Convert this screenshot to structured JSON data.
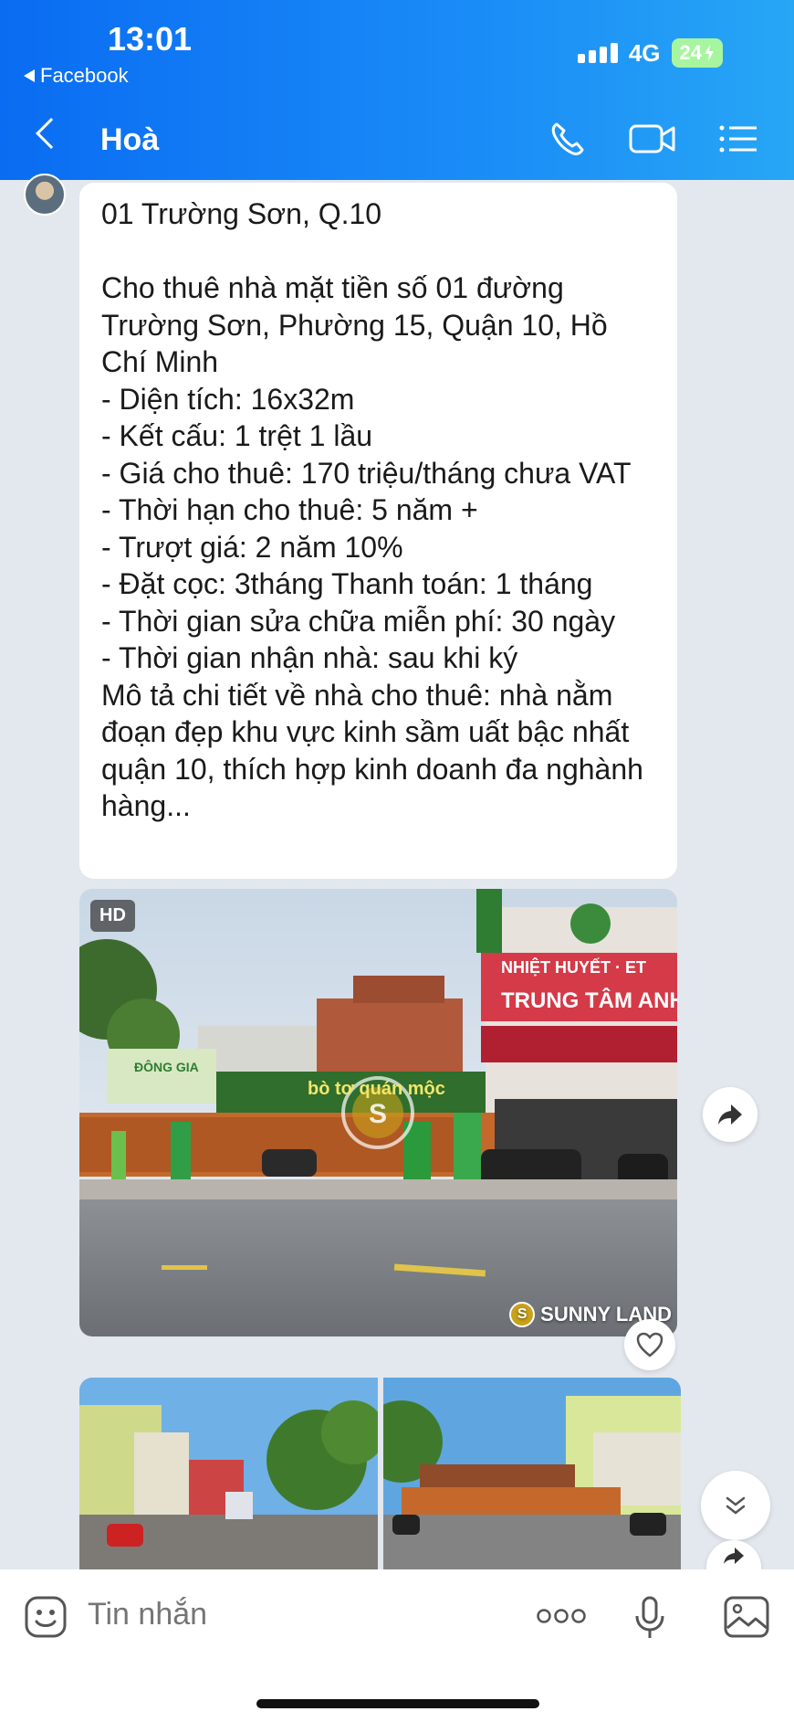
{
  "status_bar": {
    "time": "13:01",
    "back_app": "Facebook",
    "network": "4G",
    "battery": "24"
  },
  "header": {
    "title": "Hoà",
    "icons": [
      "back-icon",
      "phone-icon",
      "video-call-icon",
      "menu-list-icon"
    ]
  },
  "message": {
    "text": "01 Trường Sơn, Q.10\n\nCho thuê nhà mặt tiền số 01 đường Trường Sơn, Phường 15, Quận 10, Hồ Chí Minh\n- Diện tích: 16x32m\n- Kết cấu: 1 trệt 1 lầu\n- Giá cho thuê: 170 triệu/tháng chưa VAT\n- Thời hạn cho thuê: 5 năm +\n- Trượt giá: 2 năm 10%\n- Đặt cọc: 3tháng Thanh toán: 1 tháng\n- Thời gian sửa chữa miễn phí: 30 ngày\n- Thời gian nhận nhà: sau khi ký\nMô tả chi tiết về nhà cho thuê: nhà nằm đoạn đẹp khu vực kinh sầm uất bậc nhất quận 10, thích hợp kinh doanh đa nghành hàng..."
  },
  "photo_main": {
    "badge": "HD",
    "watermark": "SUNNY LAND",
    "sign_left": "ĐÔNG GIA",
    "sign_shop": "bò tơ quán mộc",
    "sign_center_top": "NHIỆT HUYẾT · ET",
    "sign_center": "TRUNG TÂM ANH N"
  },
  "composer": {
    "placeholder": "Tin nhắn",
    "icons": [
      "sticker-icon",
      "more-icon",
      "microphone-icon",
      "image-icon"
    ]
  },
  "colors": {
    "header_start": "#0a6cf2",
    "header_end": "#27a6f5",
    "chat_bg": "#e3e8ee",
    "battery": "#a8f5a0"
  }
}
